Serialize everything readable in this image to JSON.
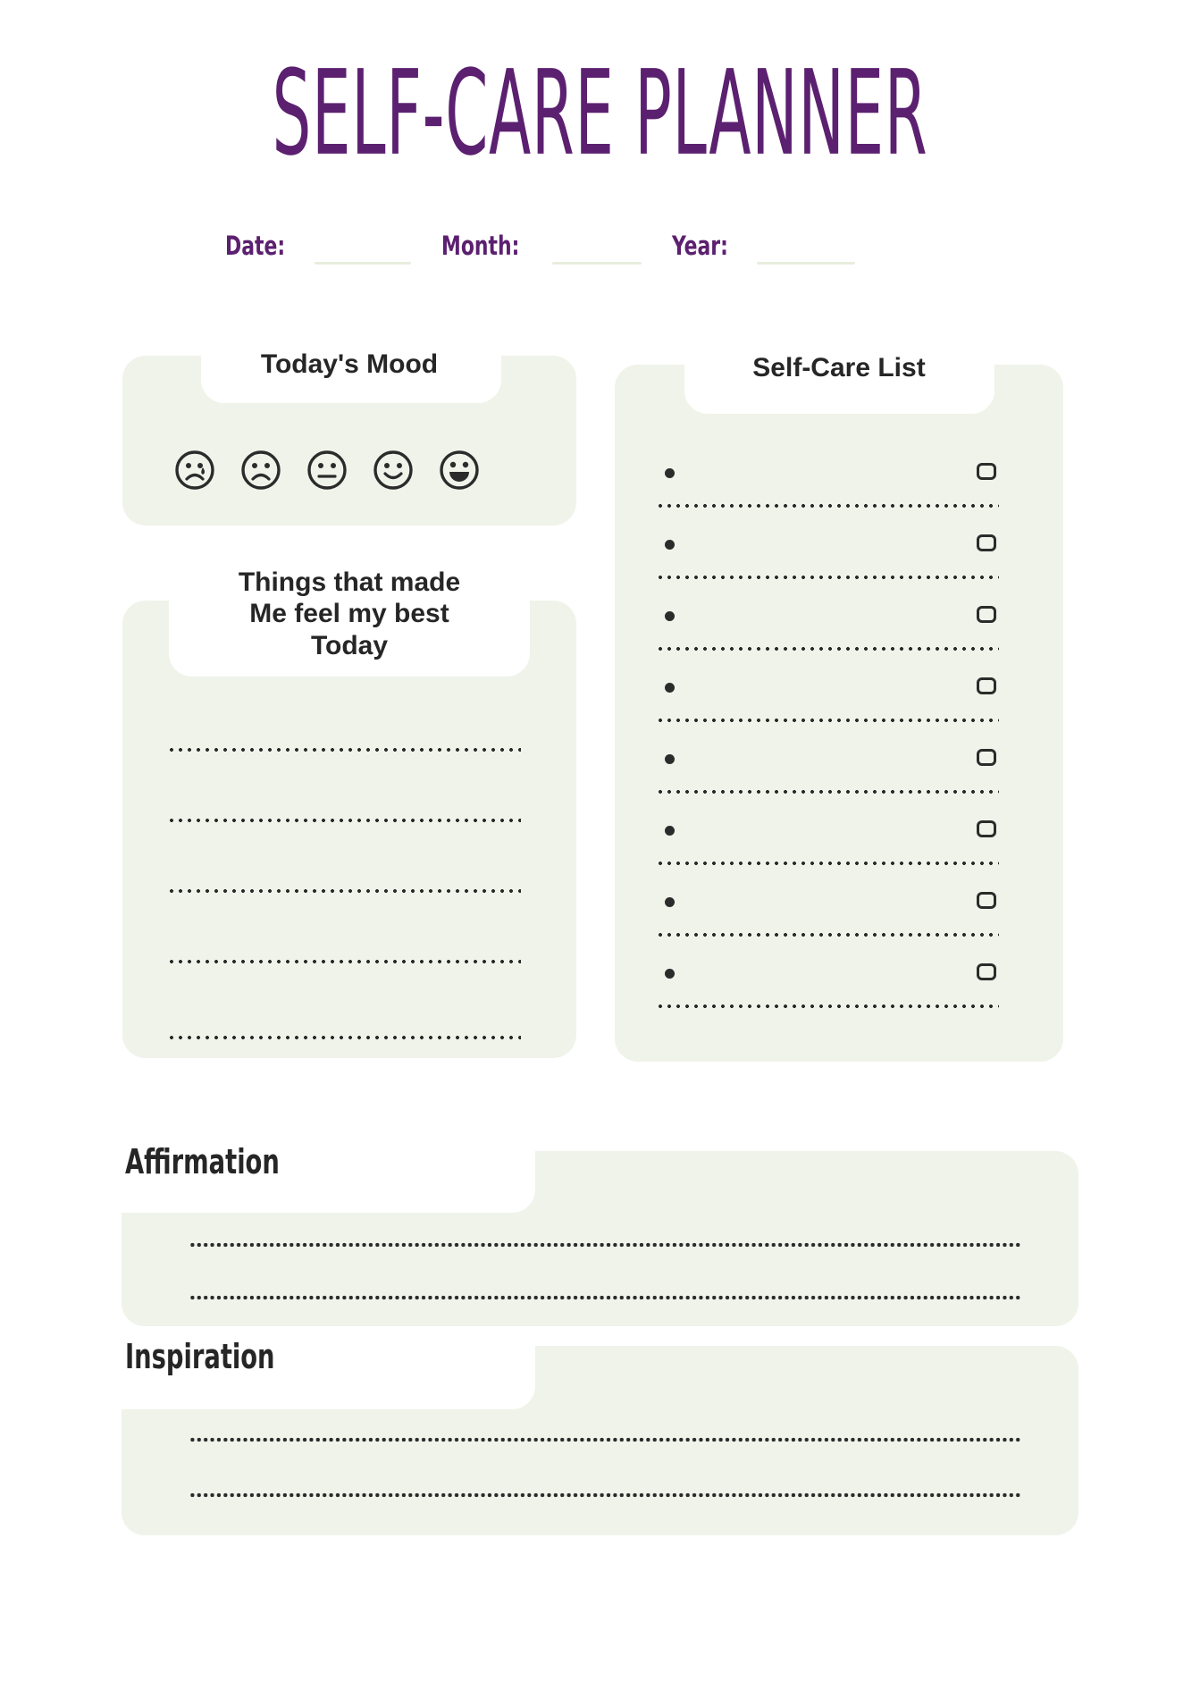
{
  "page": {
    "title": "SELF-CARE PLANNER",
    "background_color": "#ffffff",
    "accent_color": "#5c2070",
    "card_color": "#f0f3ea",
    "ink_color": "#2b2b2b"
  },
  "date_row": {
    "date_label": "Date:",
    "month_label": "Month:",
    "year_label": "Year:",
    "date_value": "",
    "month_value": "",
    "year_value": ""
  },
  "mood": {
    "title": "Today's Mood",
    "faces": [
      {
        "name": "mood-face-crying",
        "label": "crying"
      },
      {
        "name": "mood-face-sad",
        "label": "sad"
      },
      {
        "name": "mood-face-neutral",
        "label": "neutral"
      },
      {
        "name": "mood-face-happy",
        "label": "happy"
      },
      {
        "name": "mood-face-very-happy",
        "label": "very happy"
      }
    ]
  },
  "best_things": {
    "title": "Things that made\nMe feel my best\nToday",
    "lines": [
      "",
      "",
      "",
      "",
      ""
    ]
  },
  "self_care_list": {
    "title": "Self-Care List",
    "items": [
      {
        "text": "",
        "checked": false
      },
      {
        "text": "",
        "checked": false
      },
      {
        "text": "",
        "checked": false
      },
      {
        "text": "",
        "checked": false
      },
      {
        "text": "",
        "checked": false
      },
      {
        "text": "",
        "checked": false
      },
      {
        "text": "",
        "checked": false
      },
      {
        "text": "",
        "checked": false
      }
    ]
  },
  "affirmation": {
    "title": "Affirmation",
    "lines": [
      "",
      ""
    ]
  },
  "inspiration": {
    "title": "Inspiration",
    "lines": [
      "",
      ""
    ]
  }
}
